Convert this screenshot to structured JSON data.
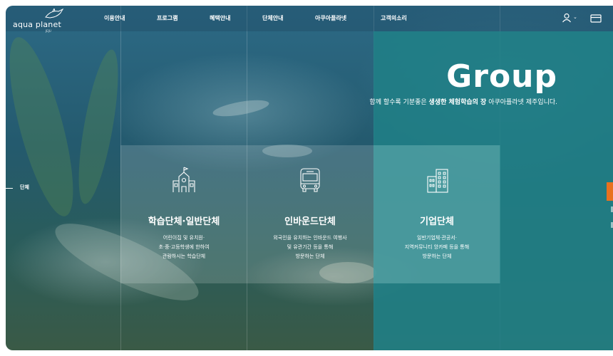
{
  "header": {
    "logo": {
      "text": "aqua planet",
      "sub": "JEJU"
    },
    "nav": [
      "이용안내",
      "프로그램",
      "혜택안내",
      "단체안내",
      "아쿠아플라넷",
      "고객의소리"
    ],
    "icons": [
      "user-icon",
      "ticket-icon"
    ]
  },
  "hero": {
    "title": "Group",
    "subtitle_pre": "함께 할수록 기분좋은 ",
    "subtitle_bold": "생생한 체험학습의 장",
    "subtitle_post": " 아쿠아플라넷 제주입니다."
  },
  "side": {
    "label": "단체"
  },
  "cards": [
    {
      "icon": "school-icon",
      "title": "학습단체·일반단체",
      "desc": [
        "어린이집 및 유치원·",
        "초·중·고등학생에 한하여",
        "관람하시는 학습단체"
      ]
    },
    {
      "icon": "bus-icon",
      "title": "인바운드단체",
      "desc": [
        "외국인을 유치하는 인바운드 여행사",
        "및 유관기간 등을 통해",
        "방문하는 단체"
      ]
    },
    {
      "icon": "building-icon",
      "title": "기업단체",
      "desc": [
        "일반기업체·관공서·",
        "지역커뮤니티 앙카페 등을 통해",
        "방문하는 단체"
      ]
    }
  ],
  "colors": {
    "accent_teal": "#208086",
    "accent_orange": "#e8711f"
  }
}
